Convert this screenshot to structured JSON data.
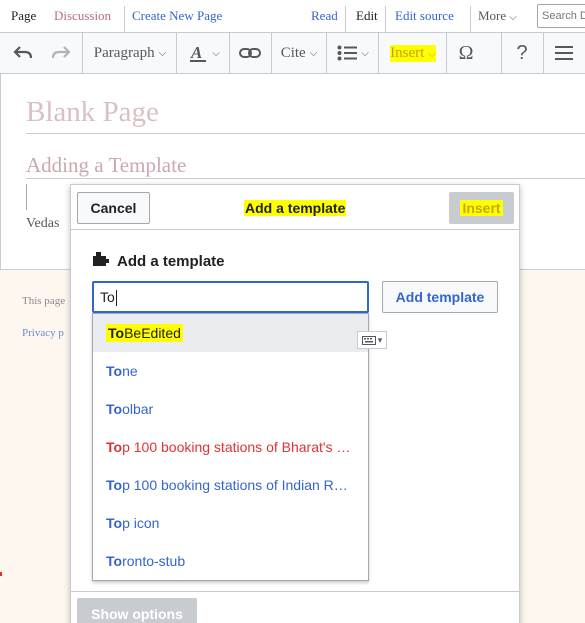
{
  "tabs": {
    "page": "Page",
    "discussion": "Discussion",
    "create": "Create New Page",
    "read": "Read",
    "edit": "Edit",
    "edit_source": "Edit source",
    "more": "More",
    "search_placeholder": "Search D"
  },
  "toolbar": {
    "paragraph": "Paragraph",
    "cite": "Cite",
    "insert": "Insert",
    "special_char": "Ω",
    "help": "?"
  },
  "page": {
    "title": "Blank Page",
    "heading": "Adding a Template",
    "body_text": "Vedas",
    "footer_text": "This page",
    "footer_link": "Privacy p"
  },
  "dialog": {
    "cancel": "Cancel",
    "title": "Add a template",
    "insert": "Insert",
    "section_title": "Add a template",
    "search_value": "To",
    "add_template": "Add template",
    "show_options": "Show options",
    "suggestions": [
      {
        "match": "To",
        "rest": "BeEdited",
        "kind": "blue",
        "selected": true,
        "highlighted": true
      },
      {
        "match": "To",
        "rest": "ne",
        "kind": "blue"
      },
      {
        "match": "To",
        "rest": "olbar",
        "kind": "blue"
      },
      {
        "match": "To",
        "rest": "p 100 booking stations of Bharat's …",
        "kind": "red"
      },
      {
        "match": "To",
        "rest": "p 100 booking stations of Indian R…",
        "kind": "blue"
      },
      {
        "match": "To",
        "rest": "p icon",
        "kind": "blue"
      },
      {
        "match": "To",
        "rest": "ronto-stub",
        "kind": "blue"
      }
    ]
  },
  "colors": {
    "link": "#3366cc",
    "redlink": "#d33333",
    "highlight": "#ffff00",
    "border": "#c8ccd1"
  }
}
